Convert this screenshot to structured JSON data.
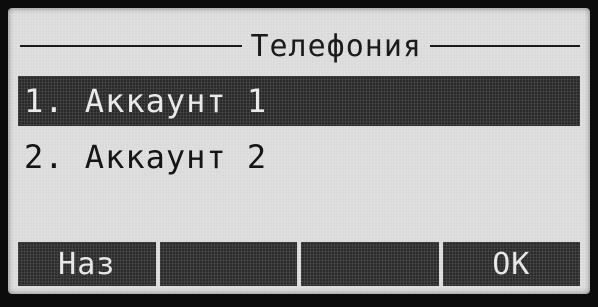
{
  "screen": {
    "title": "Телефония"
  },
  "menu": {
    "items": [
      {
        "label": "1. Аккаунт 1",
        "selected": true
      },
      {
        "label": "2. Аккаунт 2",
        "selected": false
      }
    ]
  },
  "softkeys": [
    {
      "label": "Наз"
    },
    {
      "label": ""
    },
    {
      "label": ""
    },
    {
      "label": "ОК"
    }
  ],
  "colors": {
    "lcd_background": "#dadada",
    "highlight": "#2a2a2a",
    "text_dark": "#151515",
    "text_light": "#e9e9e9"
  }
}
